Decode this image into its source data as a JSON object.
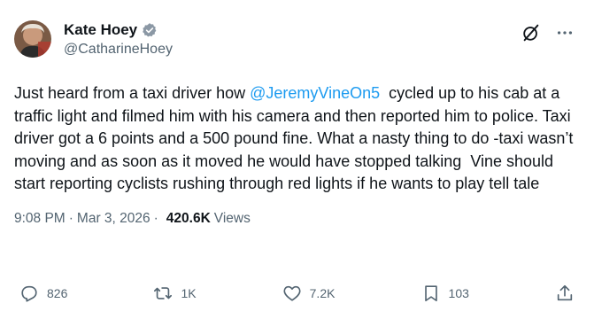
{
  "author": {
    "display_name": "Kate Hoey",
    "handle": "@CatharineHoey"
  },
  "tweet": {
    "text_before": "Just heard from a taxi driver how ",
    "mention": "@JeremyVineOn5",
    "text_after": "  cycled up to his cab at a traffic light and filmed him with his camera and then reported him to police. Taxi driver got a 6 points and a 500 pound fine. What a nasty thing to do -taxi wasn’t moving and as soon as it moved he would have stopped talking  Vine should start reporting cyclists rushing through red lights if he wants to play tell tale"
  },
  "meta": {
    "time": "9:08 PM",
    "separator": "·",
    "date": "Mar 3, 2026",
    "views_count": "420.6K",
    "views_label": "Views"
  },
  "actions": {
    "replies": "826",
    "reposts": "1K",
    "likes": "7.2K",
    "bookmarks": "103"
  },
  "icons": {
    "verified": "verified-badge-icon",
    "grok": "grok-icon",
    "more": "more-icon",
    "reply": "reply-icon",
    "repost": "repost-icon",
    "like": "like-icon",
    "bookmark": "bookmark-icon",
    "share": "share-icon"
  },
  "colors": {
    "accent": "#1d9bf0",
    "secondary_text": "#536471",
    "primary_text": "#0f1419"
  }
}
